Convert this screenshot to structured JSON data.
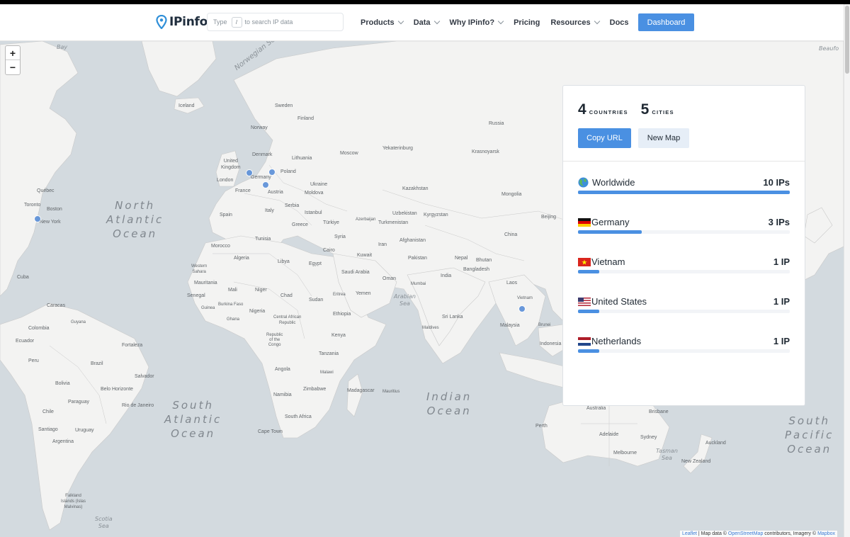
{
  "header": {
    "logo_text": "IPinfo",
    "search_prefix": "Type",
    "search_key": "/",
    "search_suffix": "to search IP data",
    "nav": [
      {
        "label": "Products",
        "dropdown": true
      },
      {
        "label": "Data",
        "dropdown": true
      },
      {
        "label": "Why IPinfo?",
        "dropdown": true
      },
      {
        "label": "Pricing",
        "dropdown": false
      },
      {
        "label": "Resources",
        "dropdown": true
      },
      {
        "label": "Docs",
        "dropdown": false
      }
    ],
    "dashboard_label": "Dashboard"
  },
  "map": {
    "zoom_in": "+",
    "zoom_out": "−",
    "oceans": {
      "north_atlantic": "North\nAtlantic\nOcean",
      "south_atlantic": "South\nAtlantic\nOcean",
      "indian": "Indian\nOcean",
      "south_pacific": "South\nPacific\nOcean"
    },
    "seas": {
      "norwegian": "Norwegian Sea",
      "arabian": "Arabian\nSea",
      "tasman": "Tasman\nSea",
      "scotia": "Scotia\nSea",
      "beaufort": "Beaufo",
      "bay": "Bay"
    },
    "places": {
      "iceland": "Iceland",
      "norway": "Norway",
      "sweden": "Sweden",
      "finland": "Finland",
      "russia": "Russia",
      "denmark": "Denmark",
      "lithuania": "Lithuania",
      "moscow": "Moscow",
      "yekaterinburg": "Yekaterinburg",
      "krasnoyarsk": "Krasnoyarsk",
      "uk": "United\nKingdom",
      "poland": "Poland",
      "germany": "Germany",
      "london": "London",
      "ukraine": "Ukraine",
      "moldova": "Moldova",
      "kazakhstan": "Kazakhstan",
      "mongolia": "Mongolia",
      "france": "France",
      "austria": "Austria",
      "serbia": "Serbia",
      "italy": "Italy",
      "spain": "Spain",
      "istanbul": "Istanbul",
      "greece": "Greece",
      "turkiye": "Türkiye",
      "uzbekistan": "Uzbekistan",
      "kyrgyzstan": "Kyrgyzstan",
      "turkmenistan": "Turkmenistan",
      "azerbaijan": "Azerbaijan",
      "beijing": "Beijing",
      "china": "China",
      "tunisia": "Tunisia",
      "syria": "Syria",
      "iran": "Iran",
      "afghanistan": "Afghanistan",
      "morocco": "Morocco",
      "algeria": "Algeria",
      "libya": "Libya",
      "cairo": "Cairo",
      "egypt": "Egypt",
      "kuwait": "Kuwait",
      "pakistan": "Pakistan",
      "nepal": "Nepal",
      "bhutan": "Bhutan",
      "bangladesh": "Bangladesh",
      "western_sahara": "Western\nSahara",
      "saudi": "Saudi Arabia",
      "oman": "Oman",
      "india": "India",
      "mumbai": "Mumbai",
      "laos": "Laos",
      "mauritania": "Mauritania",
      "mali": "Mali",
      "niger": "Niger",
      "chad": "Chad",
      "sudan": "Sudan",
      "eritrea": "Eritrea",
      "yemen": "Yemen",
      "vietnam": "Vietnam",
      "senegal": "Senegal",
      "guinea": "Guinea",
      "burkina": "Burkina Faso",
      "nigeria": "Nigeria",
      "ethiopia": "Ethiopia",
      "sri_lanka": "Sri Lanka",
      "ghana": "Ghana",
      "car": "Central African\nRepublic",
      "maldives": "Maldives",
      "malaysia": "Malaysia",
      "brunei": "Brunei",
      "congo": "Republic\nof the\nCongo",
      "kenya": "Kenya",
      "indonesia": "Indonesia",
      "tanzania": "Tanzania",
      "angola": "Angola",
      "malawi": "Malawi",
      "zimbabwe": "Zimbabwe",
      "namibia": "Namibia",
      "madagascar": "Madagascar",
      "mauritius": "Mauritius",
      "south_africa": "South Africa",
      "cape_town": "Cape Town",
      "australia": "Australia",
      "brisbane": "Brisbane",
      "perth": "Perth",
      "adelaide": "Adelaide",
      "sydney": "Sydney",
      "melbourne": "Melbourne",
      "auckland": "Auckland",
      "new_zealand": "New Zealand",
      "quebec": "Québec",
      "toronto": "Toronto",
      "boston": "Boston",
      "new_york": "New York",
      "cuba": "Cuba",
      "caracas": "Caracas",
      "guyana": "Guyana",
      "colombia": "Colombia",
      "ecuador": "Ecuador",
      "peru": "Peru",
      "fortaleza": "Fortaleza",
      "brazil": "Brazil",
      "bolivia": "Bolivia",
      "salvador": "Salvador",
      "belo": "Belo Horizonte",
      "paraguay": "Paraguay",
      "rio": "Rio de Janeiro",
      "chile": "Chile",
      "santiago": "Santiago",
      "uruguay": "Uruguay",
      "argentina": "Argentina",
      "falkland": "Falkland\nIslands (Islas\nMalvinas)"
    },
    "attribution": {
      "leaflet": "Leaflet",
      "sep": " | Map data © ",
      "osm": "OpenStreetMap",
      "mid": " contributors, Imagery © ",
      "mapbox": "Mapbox"
    },
    "marker_color": "#5b8fd8"
  },
  "panel": {
    "countries_count": "4",
    "countries_label": "COUNTRIES",
    "cities_count": "5",
    "cities_label": "CITIES",
    "copy_url_label": "Copy URL",
    "new_map_label": "New Map",
    "accent": "#4a90e2",
    "rows": [
      {
        "name": "Worldwide",
        "count": "10 IPs",
        "fraction": 1.0,
        "flag": "globe-icon"
      },
      {
        "name": "Germany",
        "count": "3 IPs",
        "fraction": 0.3,
        "flag": "germany-flag-icon"
      },
      {
        "name": "Vietnam",
        "count": "1 IP",
        "fraction": 0.1,
        "flag": "vietnam-flag-icon"
      },
      {
        "name": "United States",
        "count": "1 IP",
        "fraction": 0.1,
        "flag": "us-flag-icon"
      },
      {
        "name": "Netherlands",
        "count": "1 IP",
        "fraction": 0.1,
        "flag": "netherlands-flag-icon"
      }
    ]
  }
}
